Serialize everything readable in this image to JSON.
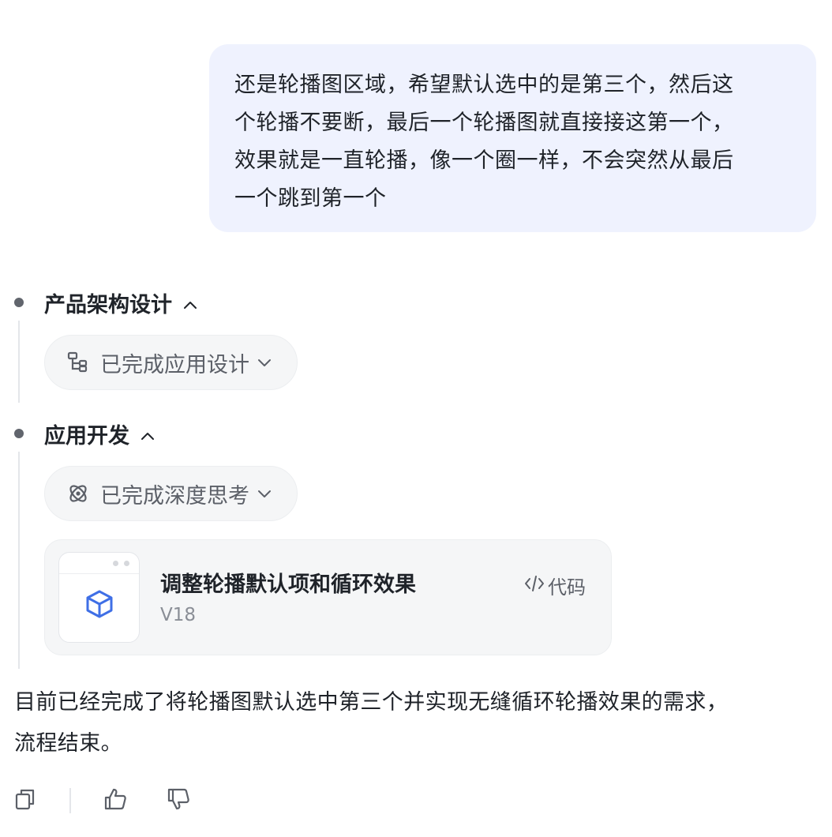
{
  "user_message": {
    "lines": [
      "还是轮播图区域，希望默认选中的是第三个，然后这",
      "个轮播不要断，最后一个轮播图就直接接这第一个，",
      "效果就是一直轮播，像一个圈一样，不会突然从最后",
      "一个跳到第一个"
    ]
  },
  "steps": [
    {
      "title": "产品架构设计",
      "status_pill": {
        "label": "已完成应用设计",
        "icon": "architecture-icon"
      }
    },
    {
      "title": "应用开发",
      "status_pill": {
        "label": "已完成深度思考",
        "icon": "deep-thinking-icon"
      },
      "artifact": {
        "title": "调整轮播默认项和循环效果",
        "version": "V18",
        "code_label": "代码",
        "icon": "cube-icon"
      }
    }
  ],
  "final_message": {
    "lines": [
      "目前已经完成了将轮播图默认选中第三个并实现无缝循环轮播效果的需求，",
      "流程结束。"
    ]
  },
  "actions": {
    "copy": "copy-icon",
    "like": "thumbs-up-icon",
    "dislike": "thumbs-down-icon"
  },
  "colors": {
    "user_bubble_bg": "#eff2fe",
    "accent_blue": "#3f6fe6",
    "pill_bg": "#f5f6f7"
  }
}
